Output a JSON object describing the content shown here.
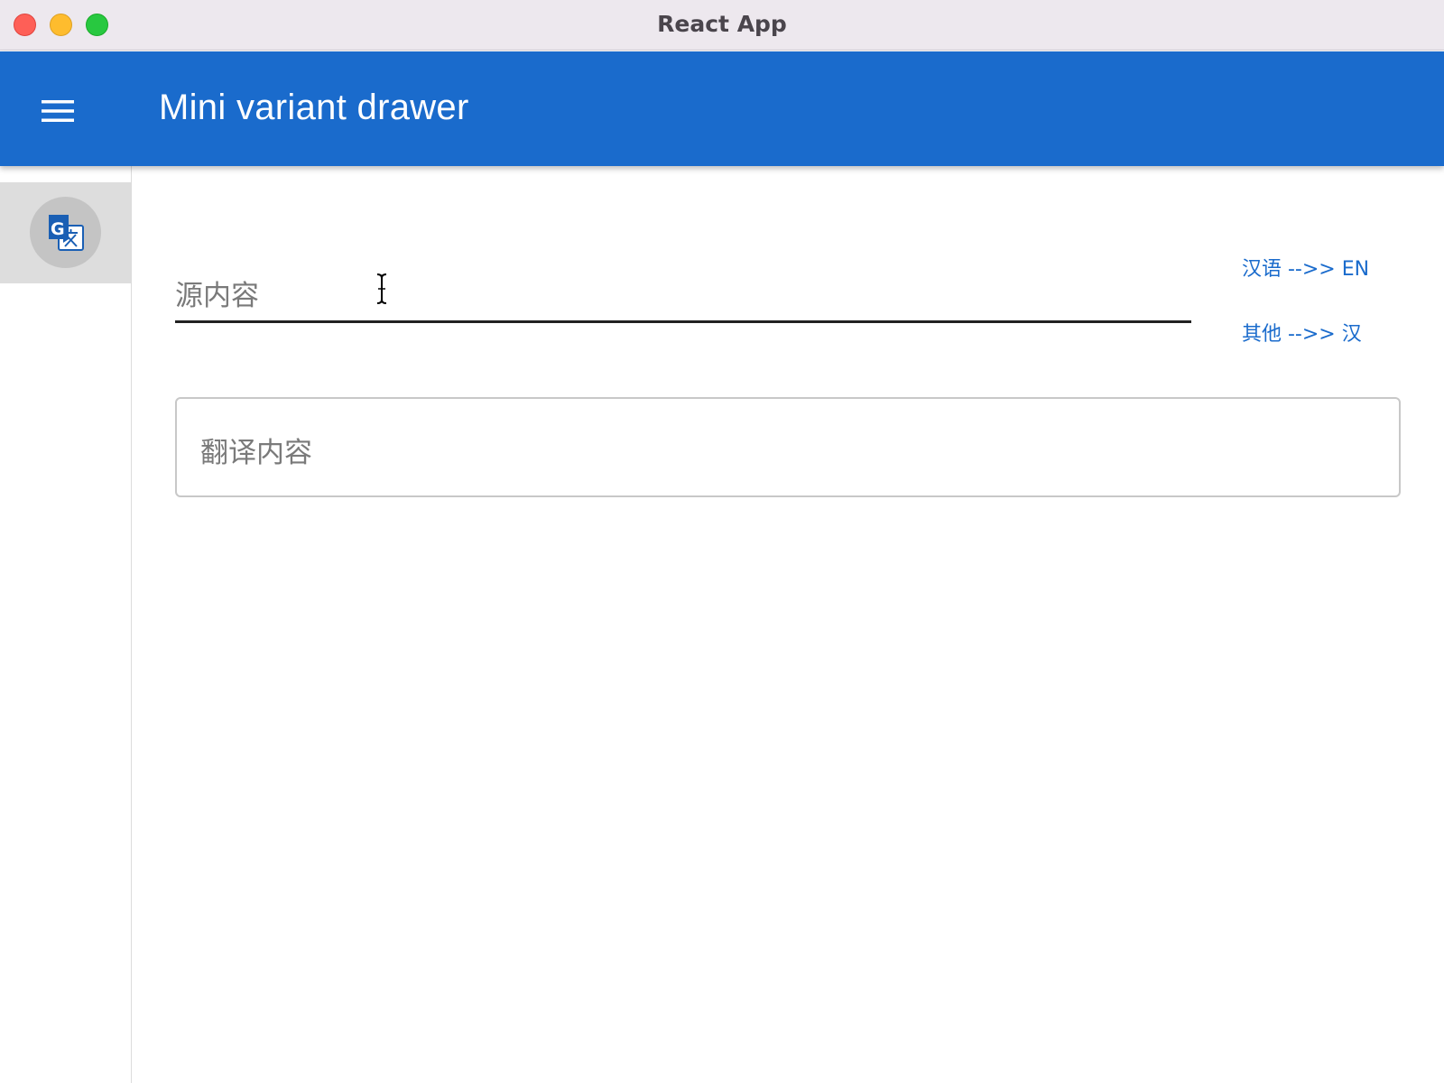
{
  "window": {
    "title": "React App"
  },
  "appbar": {
    "title": "Mini variant drawer",
    "menu_icon": "menu-icon",
    "color": "#1a6bcc"
  },
  "drawer": {
    "items": [
      {
        "icon": "google-translate-icon",
        "selected": true
      }
    ]
  },
  "main": {
    "source": {
      "placeholder": "源内容",
      "value": ""
    },
    "lang_buttons": {
      "zh_to_en": "汉语 -->> EN",
      "other_to_zh": "其他 -->> 汉"
    },
    "result": {
      "placeholder": "翻译内容",
      "value": ""
    }
  }
}
